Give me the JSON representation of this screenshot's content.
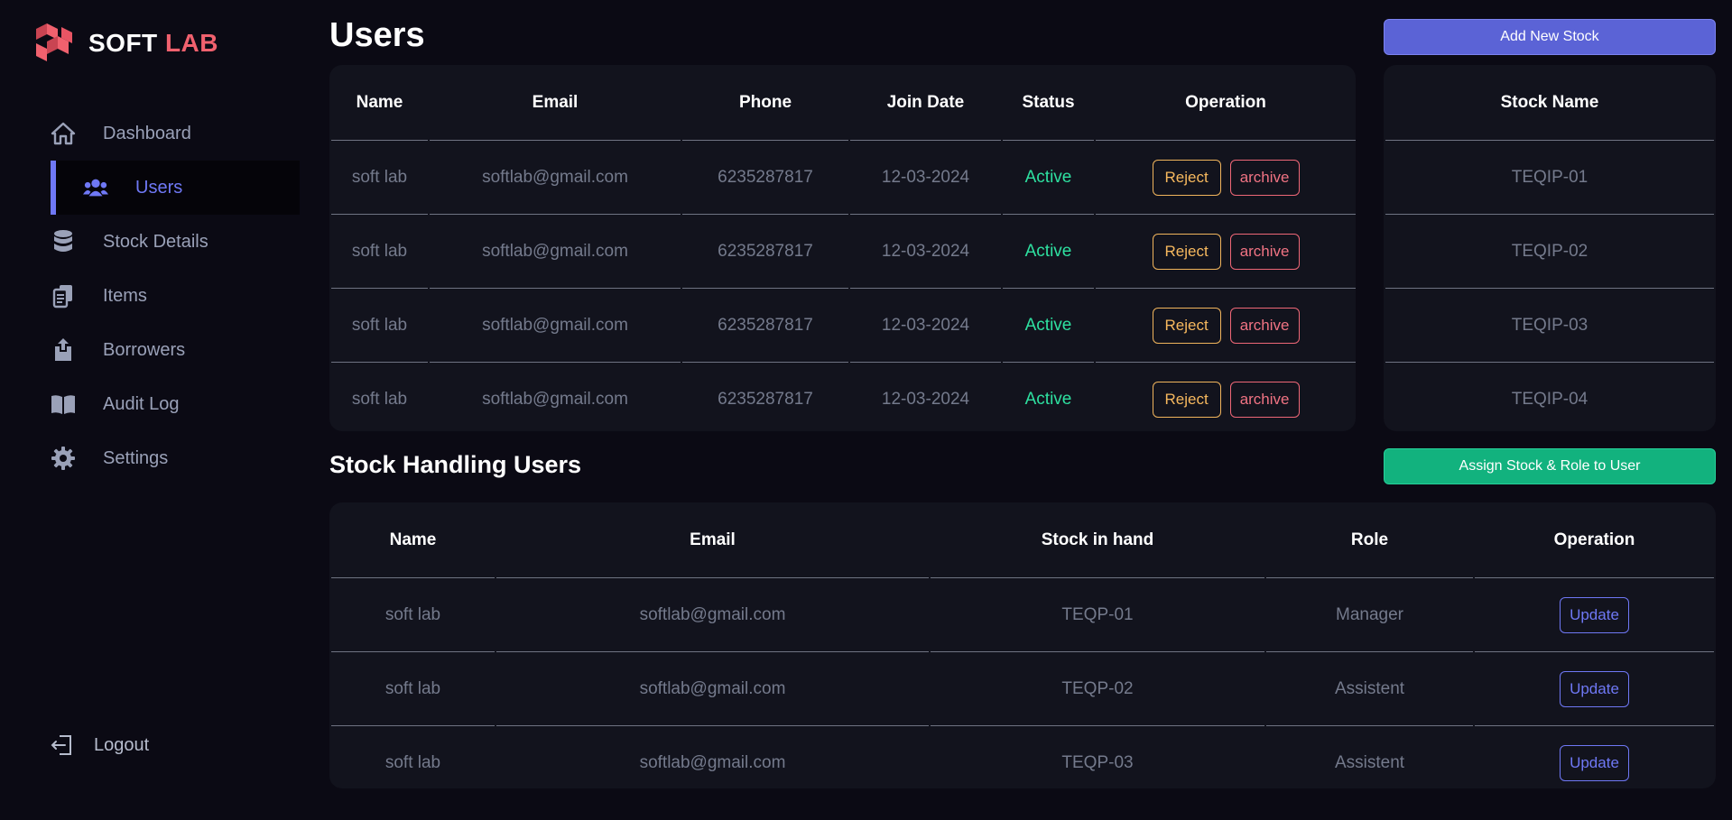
{
  "brand": {
    "name_main": "SOFT",
    "name_accent": "LAB",
    "accent_color": "#f0616e"
  },
  "nav": {
    "items": [
      {
        "label": "Dashboard",
        "icon": "home-icon"
      },
      {
        "label": "Users",
        "icon": "users-icon",
        "active": true
      },
      {
        "label": "Stock Details",
        "icon": "database-icon"
      },
      {
        "label": "Items",
        "icon": "documents-icon"
      },
      {
        "label": "Borrowers",
        "icon": "upload-icon"
      },
      {
        "label": "Audit Log",
        "icon": "book-icon"
      },
      {
        "label": "Settings",
        "icon": "gear-icon"
      }
    ],
    "logout_label": "Logout"
  },
  "users": {
    "title": "Users",
    "add_stock_label": "Add New Stock",
    "columns": [
      "Name",
      "Email",
      "Phone",
      "Join Date",
      "Status",
      "Operation"
    ],
    "rows": [
      {
        "name": "soft lab",
        "email": "softlab@gmail.com",
        "phone": "6235287817",
        "join_date": "12-03-2024",
        "status": "Active",
        "reject": "Reject",
        "archive": "archive"
      },
      {
        "name": "soft lab",
        "email": "softlab@gmail.com",
        "phone": "6235287817",
        "join_date": "12-03-2024",
        "status": "Active",
        "reject": "Reject",
        "archive": "archive"
      },
      {
        "name": "soft lab",
        "email": "softlab@gmail.com",
        "phone": "6235287817",
        "join_date": "12-03-2024",
        "status": "Active",
        "reject": "Reject",
        "archive": "archive"
      },
      {
        "name": "soft lab",
        "email": "softlab@gmail.com",
        "phone": "6235287817",
        "join_date": "12-03-2024",
        "status": "Active",
        "reject": "Reject",
        "archive": "archive"
      }
    ]
  },
  "stock": {
    "header": "Stock Name",
    "rows": [
      "TEQIP-01",
      "TEQIP-02",
      "TEQIP-03",
      "TEQIP-04"
    ]
  },
  "handling": {
    "title": "Stock Handling Users",
    "assign_label": "Assign Stock & Role to User",
    "columns": [
      "Name",
      "Email",
      "Stock in hand",
      "Role",
      "Operation"
    ],
    "rows": [
      {
        "name": "soft lab",
        "email": "softlab@gmail.com",
        "stock": "TEQP-01",
        "role": "Manager",
        "update": "Update"
      },
      {
        "name": "soft lab",
        "email": "softlab@gmail.com",
        "stock": "TEQP-02",
        "role": "Assistent",
        "update": "Update"
      },
      {
        "name": "soft lab",
        "email": "softlab@gmail.com",
        "stock": "TEQP-03",
        "role": "Assistent",
        "update": "Update"
      }
    ]
  },
  "colors": {
    "background": "#0b0a14",
    "card": "#12131d",
    "primary": "#5b63d6",
    "success": "#12b27e",
    "active_status": "#2ee0a0",
    "reject": "#f6b85e",
    "archive": "#f07383",
    "update": "#6f78f5"
  }
}
